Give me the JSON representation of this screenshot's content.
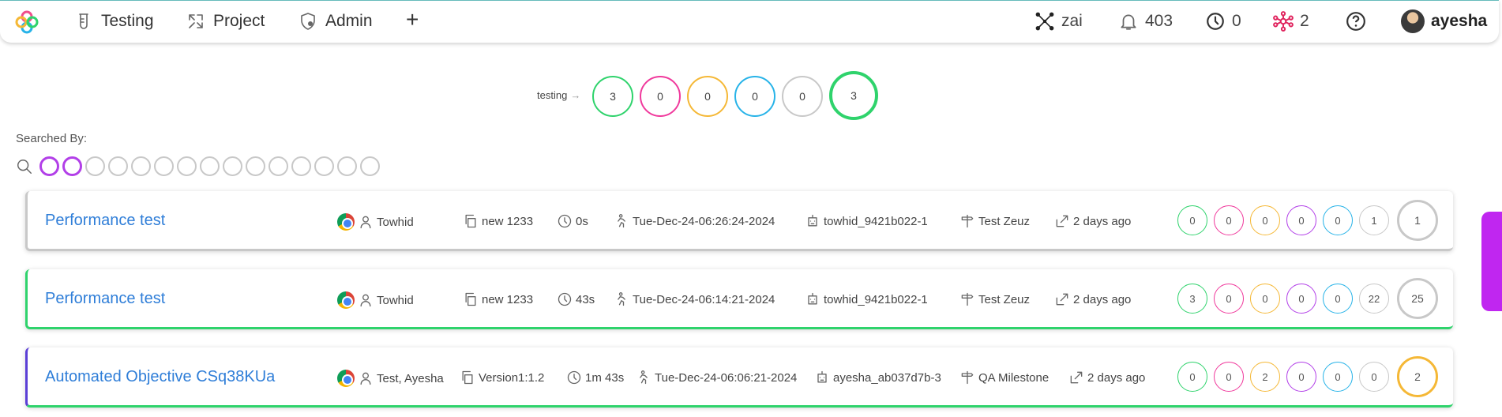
{
  "nav": {
    "items": [
      {
        "label": "Testing",
        "icon": "flask-icon"
      },
      {
        "label": "Project",
        "icon": "project-icon"
      },
      {
        "label": "Admin",
        "icon": "shield-user-icon"
      }
    ],
    "add_label": "+",
    "right": {
      "workspace": "zai",
      "notifications": "403",
      "pending": "0",
      "integrations": "2",
      "help_icon": "help-icon",
      "username": "ayesha"
    }
  },
  "summary": {
    "label": "testing",
    "counts": [
      {
        "value": "3",
        "color": "#2fd36c"
      },
      {
        "value": "0",
        "color": "#f0399c"
      },
      {
        "value": "0",
        "color": "#f5b836"
      },
      {
        "value": "0",
        "color": "#27b3e8"
      },
      {
        "value": "0",
        "color": "#c8c8c8"
      }
    ],
    "total": {
      "value": "3",
      "color": "#2fd36c"
    }
  },
  "search": {
    "label": "Searched By:",
    "filters": 15,
    "active_filters": 2,
    "active_color": "#b23fe8"
  },
  "runs": [
    {
      "title": "Performance test",
      "browser": "chrome",
      "assignee": "Towhid",
      "version": "new 1233",
      "duration": "0s",
      "started": "Tue-Dec-24-06:26:24-2024",
      "machine": "towhid_9421b022-1",
      "milestone": "Test Zeuz",
      "created": "2 days ago",
      "accent": "#c8c8c8",
      "counts": [
        "0",
        "0",
        "0",
        "0",
        "0",
        "1"
      ],
      "total": "1",
      "total_color": "#c8c8c8"
    },
    {
      "title": "Performance test",
      "browser": "chrome",
      "assignee": "Towhid",
      "version": "new 1233",
      "duration": "43s",
      "started": "Tue-Dec-24-06:14:21-2024",
      "machine": "towhid_9421b022-1",
      "milestone": "Test Zeuz",
      "created": "2 days ago",
      "accent": "#2fd36c",
      "counts": [
        "3",
        "0",
        "0",
        "0",
        "0",
        "22"
      ],
      "total": "25",
      "total_color": "#c8c8c8"
    },
    {
      "title": "Automated Objective CSq38KUa",
      "browser": "chrome",
      "assignee": "Test, Ayesha",
      "version": "Version1:1.2",
      "duration": "1m 43s",
      "started": "Tue-Dec-24-06:06:21-2024",
      "machine": "ayesha_ab037d7b-3",
      "milestone": "QA Milestone",
      "created": "2 days ago",
      "accent": "#5b3fd6",
      "bottom_accent": "#2fd36c",
      "counts": [
        "0",
        "0",
        "2",
        "0",
        "0",
        "0"
      ],
      "total": "2",
      "total_color": "#f5b836"
    }
  ],
  "count_colors": [
    "#2fd36c",
    "#f0399c",
    "#f5b836",
    "#b23fe8",
    "#27b3e8",
    "#c8c8c8"
  ]
}
